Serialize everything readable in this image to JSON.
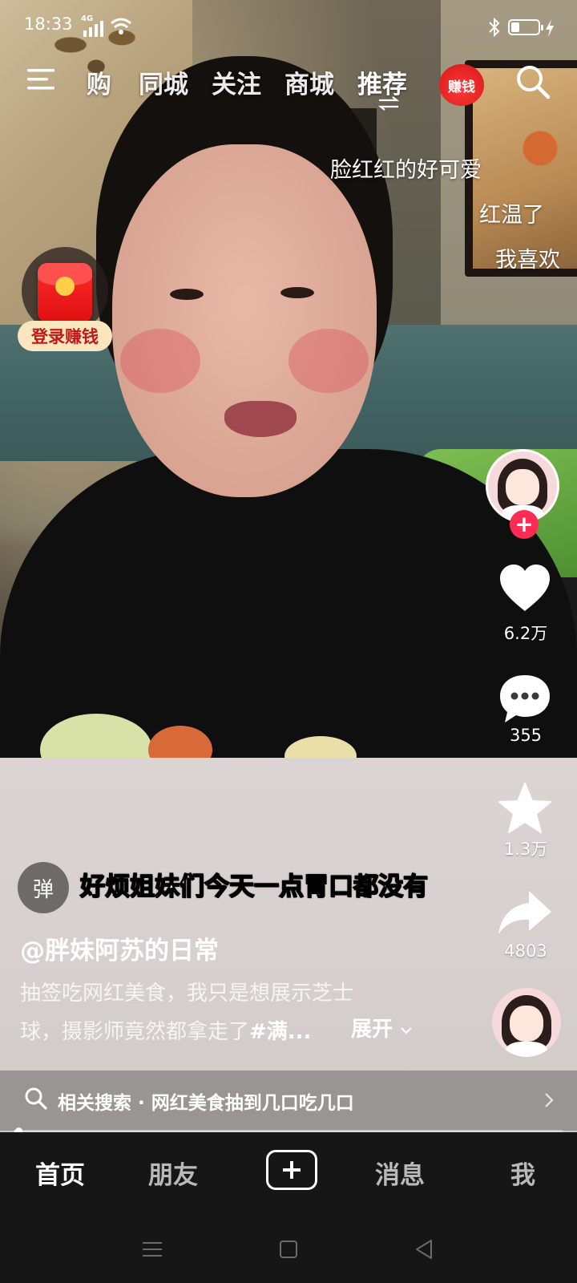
{
  "status_bar": {
    "time": "18:33",
    "network": "4G",
    "battery_level": 0.3
  },
  "top_nav": {
    "tabs": [
      {
        "label": "购"
      },
      {
        "label": "同城"
      },
      {
        "label": "关注"
      },
      {
        "label": "商城"
      },
      {
        "label": "推荐",
        "active": true
      }
    ],
    "earn_badge": "赚钱",
    "icons": [
      "menu-icon",
      "swap-icon",
      "search-icon"
    ]
  },
  "danmaku": [
    "脸红红的好可爱",
    "红温了",
    "我喜欢"
  ],
  "login_earn": {
    "label": "登录赚钱"
  },
  "right_rail": {
    "likes": "6.2万",
    "comments": "355",
    "favorites": "1.3万",
    "shares": "4803",
    "follow": "+"
  },
  "caption": {
    "danmu_toggle": "弹",
    "subtitle": "好烦姐妹们今天一点胃口都没有",
    "author": "@胖妹阿苏的日常",
    "desc_line1": "抽签吃网红美食，我只是想展示芝士",
    "desc_line2_text": "球，摄影师竟然都拿走了",
    "desc_line2_tag": "#满...",
    "expand": "展开"
  },
  "related_search": {
    "text": "相关搜索 · 网红美食抽到几口吃几口",
    "progress": 0.004
  },
  "bottom_nav": {
    "home": "首页",
    "friends": "朋友",
    "messages": "消息",
    "me": "我"
  },
  "colors": {
    "accent": "#fe2c55",
    "earn_red": "#e01010",
    "bottom_bg": "#161616"
  }
}
